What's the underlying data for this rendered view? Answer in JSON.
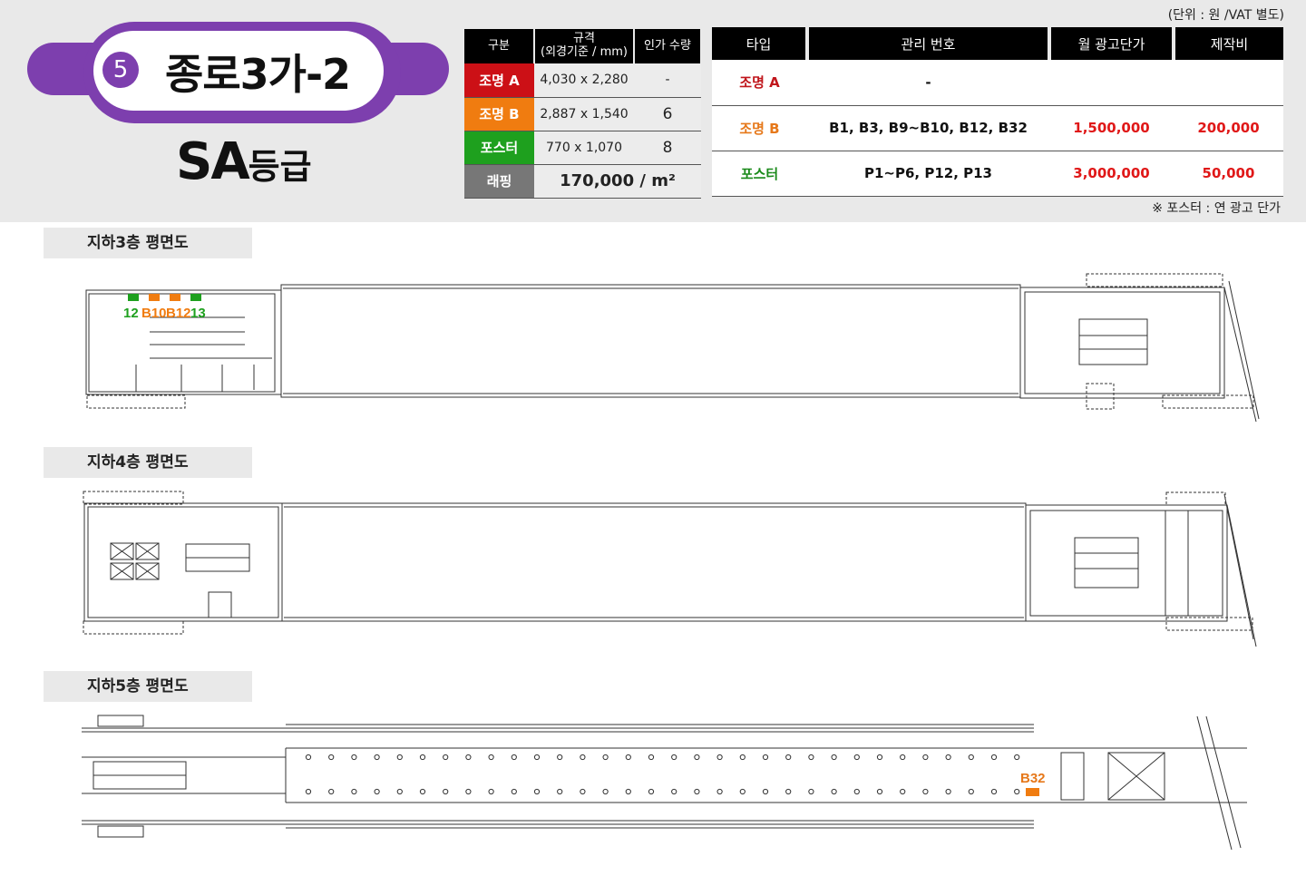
{
  "station": {
    "number": "5",
    "name": "종로3가-2",
    "grade": "SA",
    "grade_suffix": "등급"
  },
  "notes": {
    "unit": "(단위 : 원 /VAT 별도)",
    "footnote": "※ 포스터 : 연 광고 단가"
  },
  "spec_table": {
    "headers": [
      "구분",
      "규격",
      "(외경기준 / mm)",
      "인가 수량"
    ],
    "rows": [
      {
        "category": "조명 A",
        "size": "4,030 x 2,280",
        "qty": "-"
      },
      {
        "category": "조명 B",
        "size": "2,887 x 1,540",
        "qty": "6"
      },
      {
        "category": "포스터",
        "size": "770 x 1,070",
        "qty": "8"
      }
    ],
    "wrapping": {
      "category": "래핑",
      "price": "170,000 / m²"
    }
  },
  "price_table": {
    "headers": [
      "타입",
      "관리 번호",
      "월 광고단가",
      "제작비"
    ],
    "rows": [
      {
        "type": "조명 A",
        "ids": "-",
        "monthly": "",
        "production": ""
      },
      {
        "type": "조명 B",
        "ids": "B1, B3, B9~B10, B12, B32",
        "monthly": "1,500,000",
        "production": "200,000"
      },
      {
        "type": "포스터",
        "ids": "P1~P6, P12, P13",
        "monthly": "3,000,000",
        "production": "50,000"
      }
    ]
  },
  "colors": {
    "purple": "#7d3fae",
    "red": "#cc1016",
    "orange": "#f07c10",
    "green": "#1ea01e",
    "gray": "#777777"
  },
  "floors": [
    {
      "label": "지하3층 평면도",
      "markers": [
        "12",
        "B10",
        "B12",
        "13"
      ]
    },
    {
      "label": "지하4층 평면도",
      "markers": []
    },
    {
      "label": "지하5층 평면도",
      "markers": [
        "B32"
      ]
    }
  ]
}
